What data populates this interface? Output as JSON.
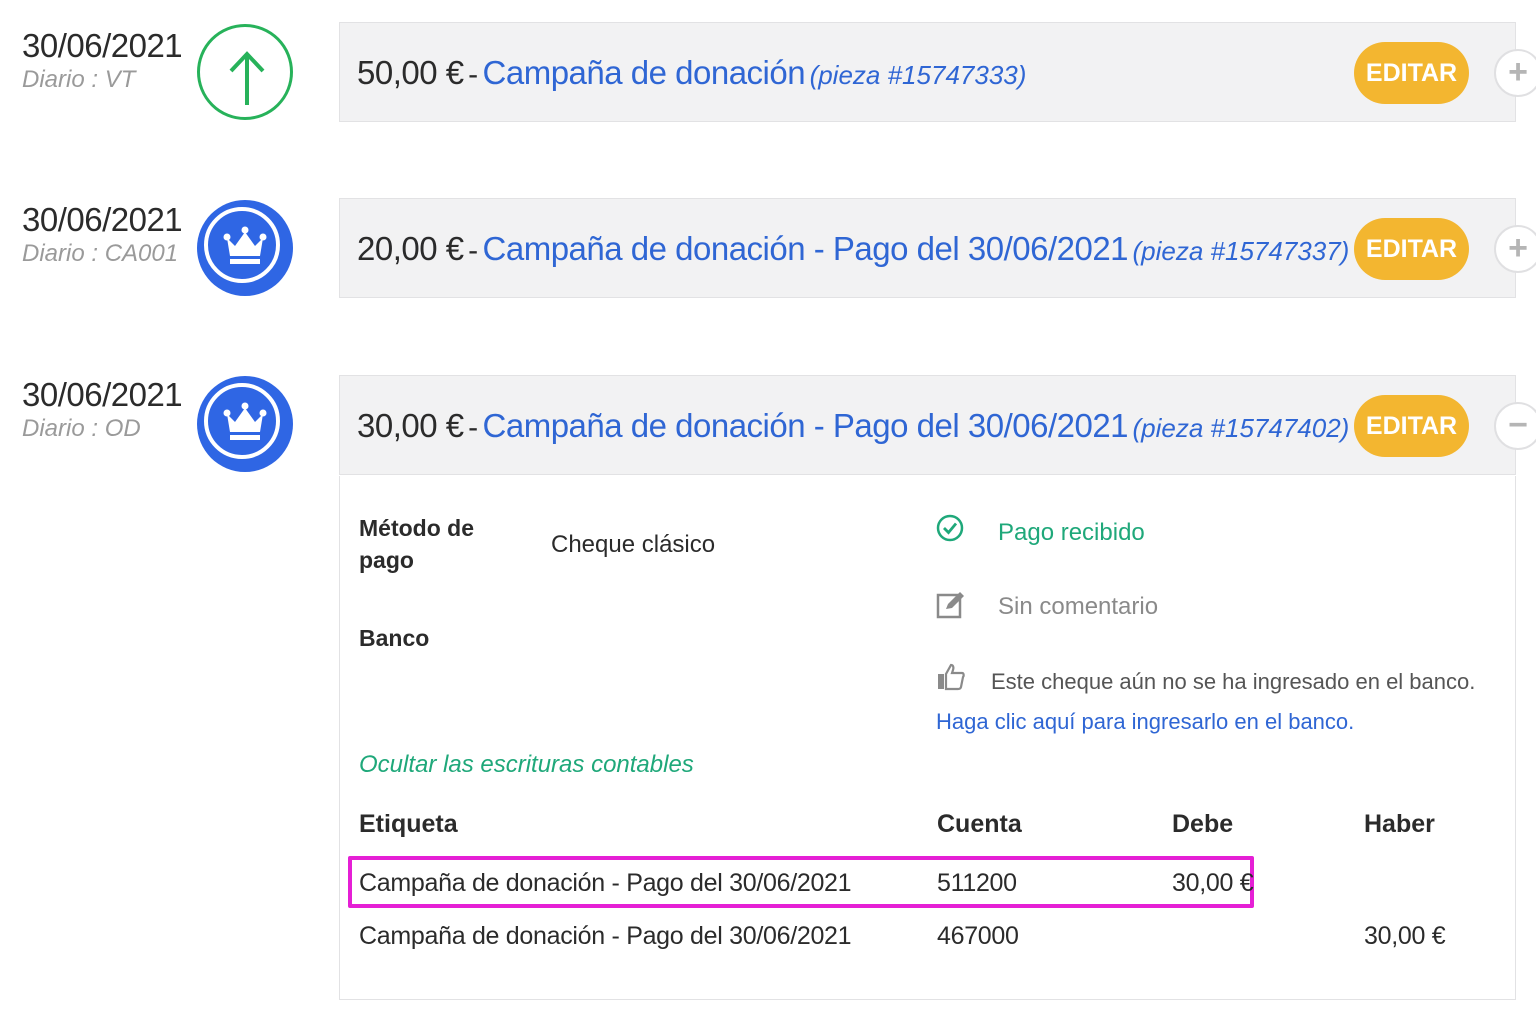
{
  "entries": [
    {
      "date": "30/06/2021",
      "journal": "Diario : VT",
      "badge_icon": "arrow-up-icon",
      "amount": "50,00 €",
      "separator": "-",
      "title": "Campaña de donación",
      "piece": "(pieza #15747333)",
      "edit_label": "EDITAR",
      "toggle_symbol": "+"
    },
    {
      "date": "30/06/2021",
      "journal": "Diario : CA001",
      "badge_icon": "crown-icon",
      "amount": "20,00 €",
      "separator": "-",
      "title": "Campaña de donación - Pago del 30/06/2021",
      "piece": "(pieza #15747337)",
      "edit_label": "EDITAR",
      "toggle_symbol": "+"
    },
    {
      "date": "30/06/2021",
      "journal": "Diario : OD",
      "badge_icon": "crown-icon",
      "amount": "30,00 €",
      "separator": "-",
      "title": "Campaña de donación - Pago del 30/06/2021",
      "piece": "(pieza #15747402)",
      "edit_label": "EDITAR",
      "toggle_symbol": "−"
    }
  ],
  "details": {
    "payment_method_label": "Método de pago",
    "payment_method_value": "Cheque clásico",
    "bank_label": "Banco",
    "status_received": "Pago recibido",
    "comment": "Sin comentario",
    "deposit_notice": "Este cheque aún no se ha ingresado en el banco.",
    "deposit_link": "Haga clic aquí para ingresarlo en el banco.",
    "hide_entries_link": "Ocultar las escrituras contables",
    "table": {
      "headers": [
        "Etiqueta",
        "Cuenta",
        "Debe",
        "Haber"
      ],
      "rows": [
        [
          "Campaña de donación - Pago del 30/06/2021",
          "511200",
          "30,00 €",
          ""
        ],
        [
          "Campaña de donación - Pago del 30/06/2021",
          "467000",
          "",
          "30,00 €"
        ]
      ]
    }
  },
  "colors": {
    "accent_blue": "#2f66d4",
    "edit_orange": "#f3b630",
    "success_green": "#1fa87a",
    "highlight_magenta": "#e51fd5"
  }
}
